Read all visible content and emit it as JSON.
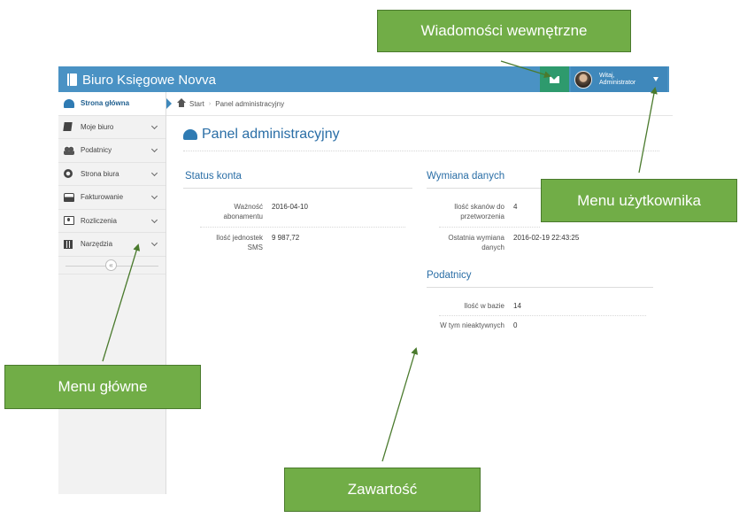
{
  "header": {
    "brand": "Biuro Księgowe Novva",
    "user": {
      "greeting": "Witaj,",
      "name": "Administrator"
    }
  },
  "sidebar": {
    "items": [
      {
        "label": "Strona główna",
        "icon": "dashboard-icon",
        "active": true
      },
      {
        "label": "Moje biuro",
        "icon": "book-icon"
      },
      {
        "label": "Podatnicy",
        "icon": "users-icon"
      },
      {
        "label": "Strona biura",
        "icon": "cogs-icon"
      },
      {
        "label": "Fakturowanie",
        "icon": "hdd-icon"
      },
      {
        "label": "Rozliczenia",
        "icon": "money-icon"
      },
      {
        "label": "Narzędzia",
        "icon": "calculator-icon"
      }
    ],
    "collapse_glyph": "«"
  },
  "breadcrumb": {
    "home": "Start",
    "separator": "›",
    "current": "Panel administracyjny"
  },
  "page": {
    "title": "Panel administracyjny"
  },
  "status_konta": {
    "title": "Status konta",
    "rows": [
      {
        "label": "Ważność abonamentu",
        "value": "2016-04-10"
      },
      {
        "label": "Ilość jednostek SMS",
        "value": "9 987,72"
      }
    ]
  },
  "wymiana_danych": {
    "title": "Wymiana danych",
    "rows": [
      {
        "label": "Ilość skanów do przetworzenia",
        "value": "4"
      },
      {
        "label": "Ostatnia wymiana danych",
        "value": "2016-02-19 22:43:25"
      }
    ]
  },
  "podatnicy": {
    "title": "Podatnicy",
    "rows": [
      {
        "label": "Ilość w bazie",
        "value": "14"
      },
      {
        "label": "W tym nieaktywnych",
        "value": "0"
      }
    ]
  },
  "annotations": {
    "wiadomosci": "Wiadomości wewnętrzne",
    "menu_uzytkownika": "Menu użytkownika",
    "menu_glowne": "Menu główne",
    "zawartosc": "Zawartość"
  },
  "colors": {
    "header": "#4a92c4",
    "messages_button": "#2e9a6d",
    "callout": "#71ad47",
    "title": "#2a6ea6"
  }
}
